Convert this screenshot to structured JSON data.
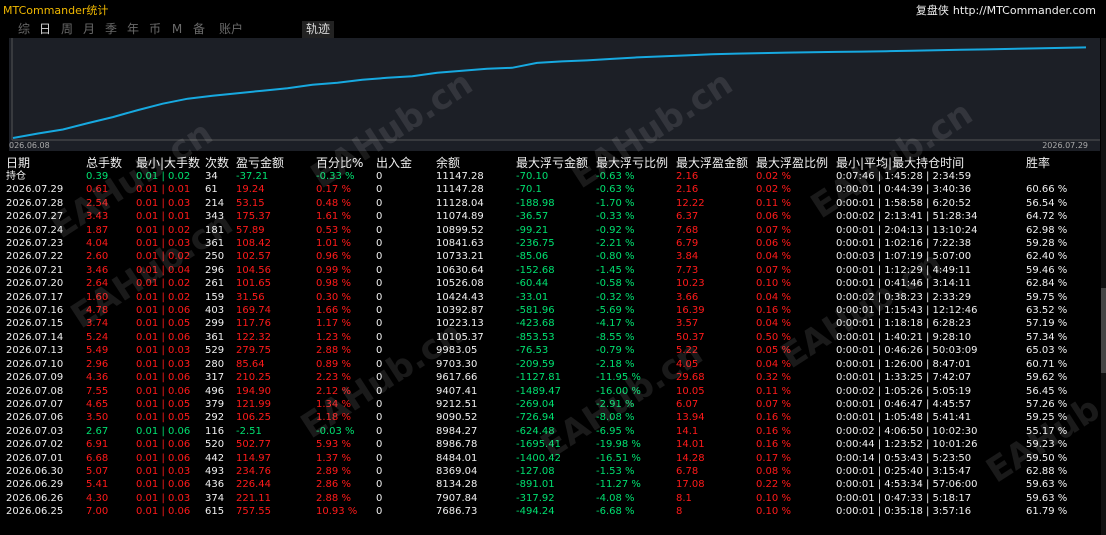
{
  "app_title": "MTCommander统计",
  "brand": {
    "name": "复盘侠",
    "url": "http://MTCommander.com"
  },
  "tabs": [
    "综",
    "日",
    "周",
    "月",
    "季",
    "年",
    "币",
    "M",
    "备",
    "账户"
  ],
  "active_tab": "日",
  "track_tab": "轨迹",
  "chart": {
    "start_label": "026.06.08",
    "end_label": "2026.07.29",
    "line_color": "#17a9e0",
    "values": [
      0,
      0.45,
      0.85,
      1.5,
      2.1,
      2.8,
      3.45,
      3.95,
      4.25,
      4.5,
      4.75,
      5.0,
      5.35,
      5.55,
      5.85,
      6.05,
      6.2,
      6.55,
      6.75,
      6.95,
      7.05,
      7.55,
      7.7,
      7.8,
      7.95,
      8.1,
      8.2,
      8.3,
      8.42,
      8.48,
      8.53,
      8.58,
      8.62,
      8.65,
      8.68,
      8.72,
      8.77,
      8.82,
      8.86,
      8.9,
      8.95,
      9.0,
      9.05,
      9.1
    ]
  },
  "table": {
    "headers": [
      "日期",
      "总手数",
      "最小|大手数",
      "次数",
      "盈亏金额",
      "百分比%",
      "出入金",
      "余额",
      "最大浮亏金额",
      "最大浮亏比例",
      "最大浮盈金额",
      "最大浮盈比例",
      "最小|平均|最大持仓时间",
      "胜率"
    ],
    "summary": [
      "持仓",
      "0.39",
      "0.01 | 0.02",
      "34",
      "-37.21",
      "-0.33 %",
      "0",
      "11147.28",
      "-70.10",
      "-0.63 %",
      "2.16",
      "0.02 %",
      "0:07:46 | 1:45:28 | 2:34:59",
      ""
    ],
    "rows": [
      [
        "2026.07.29",
        "0.61",
        "0.01 | 0.01",
        "61",
        "19.24",
        "0.17 %",
        "0",
        "11147.28",
        "-70.1",
        "-0.63 %",
        "2.16",
        "0.02 %",
        "0:00:01 | 0:44:39 | 3:40:36",
        "60.66 %"
      ],
      [
        "2026.07.28",
        "2.54",
        "0.01 | 0.03",
        "214",
        "53.15",
        "0.48 %",
        "0",
        "11128.04",
        "-188.98",
        "-1.70 %",
        "12.22",
        "0.11 %",
        "0:00:01 | 1:58:58 | 6:20:52",
        "56.54 %"
      ],
      [
        "2026.07.27",
        "3.43",
        "0.01 | 0.01",
        "343",
        "175.37",
        "1.61 %",
        "0",
        "11074.89",
        "-36.57",
        "-0.33 %",
        "6.37",
        "0.06 %",
        "0:00:02 | 2:13:41 | 51:28:34",
        "64.72 %"
      ],
      [
        "2026.07.24",
        "1.87",
        "0.01 | 0.02",
        "181",
        "57.89",
        "0.53 %",
        "0",
        "10899.52",
        "-99.21",
        "-0.92 %",
        "7.68",
        "0.07 %",
        "0:00:01 | 2:04:13 | 13:10:24",
        "62.98 %"
      ],
      [
        "2026.07.23",
        "4.04",
        "0.01 | 0.03",
        "361",
        "108.42",
        "1.01 %",
        "0",
        "10841.63",
        "-236.75",
        "-2.21 %",
        "6.79",
        "0.06 %",
        "0:00:01 | 1:02:16 | 7:22:38",
        "59.28 %"
      ],
      [
        "2026.07.22",
        "2.60",
        "0.01 | 0.02",
        "250",
        "102.57",
        "0.96 %",
        "0",
        "10733.21",
        "-85.06",
        "-0.80 %",
        "3.84",
        "0.04 %",
        "0:00:03 | 1:07:19 | 5:07:00",
        "62.40 %"
      ],
      [
        "2026.07.21",
        "3.46",
        "0.01 | 0.04",
        "296",
        "104.56",
        "0.99 %",
        "0",
        "10630.64",
        "-152.68",
        "-1.45 %",
        "7.73",
        "0.07 %",
        "0:00:01 | 1:12:29 | 4:49:11",
        "59.46 %"
      ],
      [
        "2026.07.20",
        "2.64",
        "0.01 | 0.02",
        "261",
        "101.65",
        "0.98 %",
        "0",
        "10526.08",
        "-60.44",
        "-0.58 %",
        "10.23",
        "0.10 %",
        "0:00:01 | 0:41:46 | 3:14:11",
        "62.84 %"
      ],
      [
        "2026.07.17",
        "1.60",
        "0.01 | 0.02",
        "159",
        "31.56",
        "0.30 %",
        "0",
        "10424.43",
        "-33.01",
        "-0.32 %",
        "3.66",
        "0.04 %",
        "0:00:02 | 0:38:23 | 2:33:29",
        "59.75 %"
      ],
      [
        "2026.07.16",
        "4.78",
        "0.01 | 0.06",
        "403",
        "169.74",
        "1.66 %",
        "0",
        "10392.87",
        "-581.96",
        "-5.69 %",
        "16.39",
        "0.16 %",
        "0:00:01 | 1:15:43 | 12:12:46",
        "63.52 %"
      ],
      [
        "2026.07.15",
        "3.74",
        "0.01 | 0.05",
        "299",
        "117.76",
        "1.17 %",
        "0",
        "10223.13",
        "-423.68",
        "-4.17 %",
        "3.57",
        "0.04 %",
        "0:00:01 | 1:18:18 | 6:28:23",
        "57.19 %"
      ],
      [
        "2026.07.14",
        "5.24",
        "0.01 | 0.06",
        "361",
        "122.32",
        "1.23 %",
        "0",
        "10105.37",
        "-853.53",
        "-8.55 %",
        "50.37",
        "0.50 %",
        "0:00:01 | 1:40:21 | 9:28:10",
        "57.34 %"
      ],
      [
        "2026.07.13",
        "5.49",
        "0.01 | 0.03",
        "529",
        "279.75",
        "2.88 %",
        "0",
        "9983.05",
        "-76.53",
        "-0.79 %",
        "5.22",
        "0.05 %",
        "0:00:01 | 0:46:26 | 50:03:09",
        "65.03 %"
      ],
      [
        "2026.07.10",
        "2.96",
        "0.01 | 0.03",
        "280",
        "85.64",
        "0.89 %",
        "0",
        "9703.30",
        "-209.59",
        "-2.18 %",
        "4.05",
        "0.04 %",
        "0:00:01 | 1:26:00 | 8:47:01",
        "60.71 %"
      ],
      [
        "2026.07.09",
        "4.36",
        "0.01 | 0.06",
        "317",
        "210.25",
        "2.23 %",
        "0",
        "9617.66",
        "-1127.81",
        "-11.95 %",
        "29.68",
        "0.32 %",
        "0:00:01 | 1:33:25 | 7:42:07",
        "59.62 %"
      ],
      [
        "2026.07.08",
        "7.55",
        "0.01 | 0.06",
        "496",
        "194.90",
        "2.12 %",
        "0",
        "9407.41",
        "-1489.47",
        "-16.00 %",
        "10.05",
        "0.11 %",
        "0:00:02 | 1:05:26 | 5:05:19",
        "56.45 %"
      ],
      [
        "2026.07.07",
        "4.65",
        "0.01 | 0.05",
        "379",
        "121.99",
        "1.34 %",
        "0",
        "9212.51",
        "-269.04",
        "-2.91 %",
        "6.07",
        "0.07 %",
        "0:00:01 | 0:46:47 | 4:45:57",
        "57.26 %"
      ],
      [
        "2026.07.06",
        "3.50",
        "0.01 | 0.05",
        "292",
        "106.25",
        "1.18 %",
        "0",
        "9090.52",
        "-726.94",
        "-8.08 %",
        "13.94",
        "0.16 %",
        "0:00:01 | 1:05:48 | 5:41:41",
        "59.25 %"
      ],
      [
        "2026.07.03",
        "2.67",
        "0.01 | 0.06",
        "116",
        "-2.51",
        "-0.03 %",
        "0",
        "8984.27",
        "-624.48",
        "-6.95 %",
        "14.1",
        "0.16 %",
        "0:00:02 | 4:06:50 | 10:02:30",
        "55.17 %"
      ],
      [
        "2026.07.02",
        "6.91",
        "0.01 | 0.06",
        "520",
        "502.77",
        "5.93 %",
        "0",
        "8986.78",
        "-1695.41",
        "-19.98 %",
        "14.01",
        "0.16 %",
        "0:00:44 | 1:23:52 | 10:01:26",
        "59.23 %"
      ],
      [
        "2026.07.01",
        "6.68",
        "0.01 | 0.06",
        "442",
        "114.97",
        "1.37 %",
        "0",
        "8484.01",
        "-1400.42",
        "-16.51 %",
        "14.28",
        "0.17 %",
        "0:00:14 | 0:53:43 | 5:23:50",
        "59.50 %"
      ],
      [
        "2026.06.30",
        "5.07",
        "0.01 | 0.03",
        "493",
        "234.76",
        "2.89 %",
        "0",
        "8369.04",
        "-127.08",
        "-1.53 %",
        "6.78",
        "0.08 %",
        "0:00:01 | 0:25:40 | 3:15:47",
        "62.88 %"
      ],
      [
        "2026.06.29",
        "5.41",
        "0.01 | 0.06",
        "436",
        "226.44",
        "2.86 %",
        "0",
        "8134.28",
        "-891.01",
        "-11.27 %",
        "17.08",
        "0.22 %",
        "0:00:01 | 4:53:34 | 57:06:00",
        "59.63 %"
      ],
      [
        "2026.06.26",
        "4.30",
        "0.01 | 0.03",
        "374",
        "221.11",
        "2.88 %",
        "0",
        "7907.84",
        "-317.92",
        "-4.08 %",
        "8.1",
        "0.10 %",
        "0:00:01 | 0:47:33 | 5:18:17",
        "59.63 %"
      ],
      [
        "2026.06.25",
        "7.00",
        "0.01 | 0.06",
        "615",
        "757.55",
        "10.93 %",
        "0",
        "7686.73",
        "-494.24",
        "-6.68 %",
        "8",
        "0.10 %",
        "0:00:01 | 0:35:18 | 3:57:16",
        "61.79 %"
      ]
    ]
  }
}
